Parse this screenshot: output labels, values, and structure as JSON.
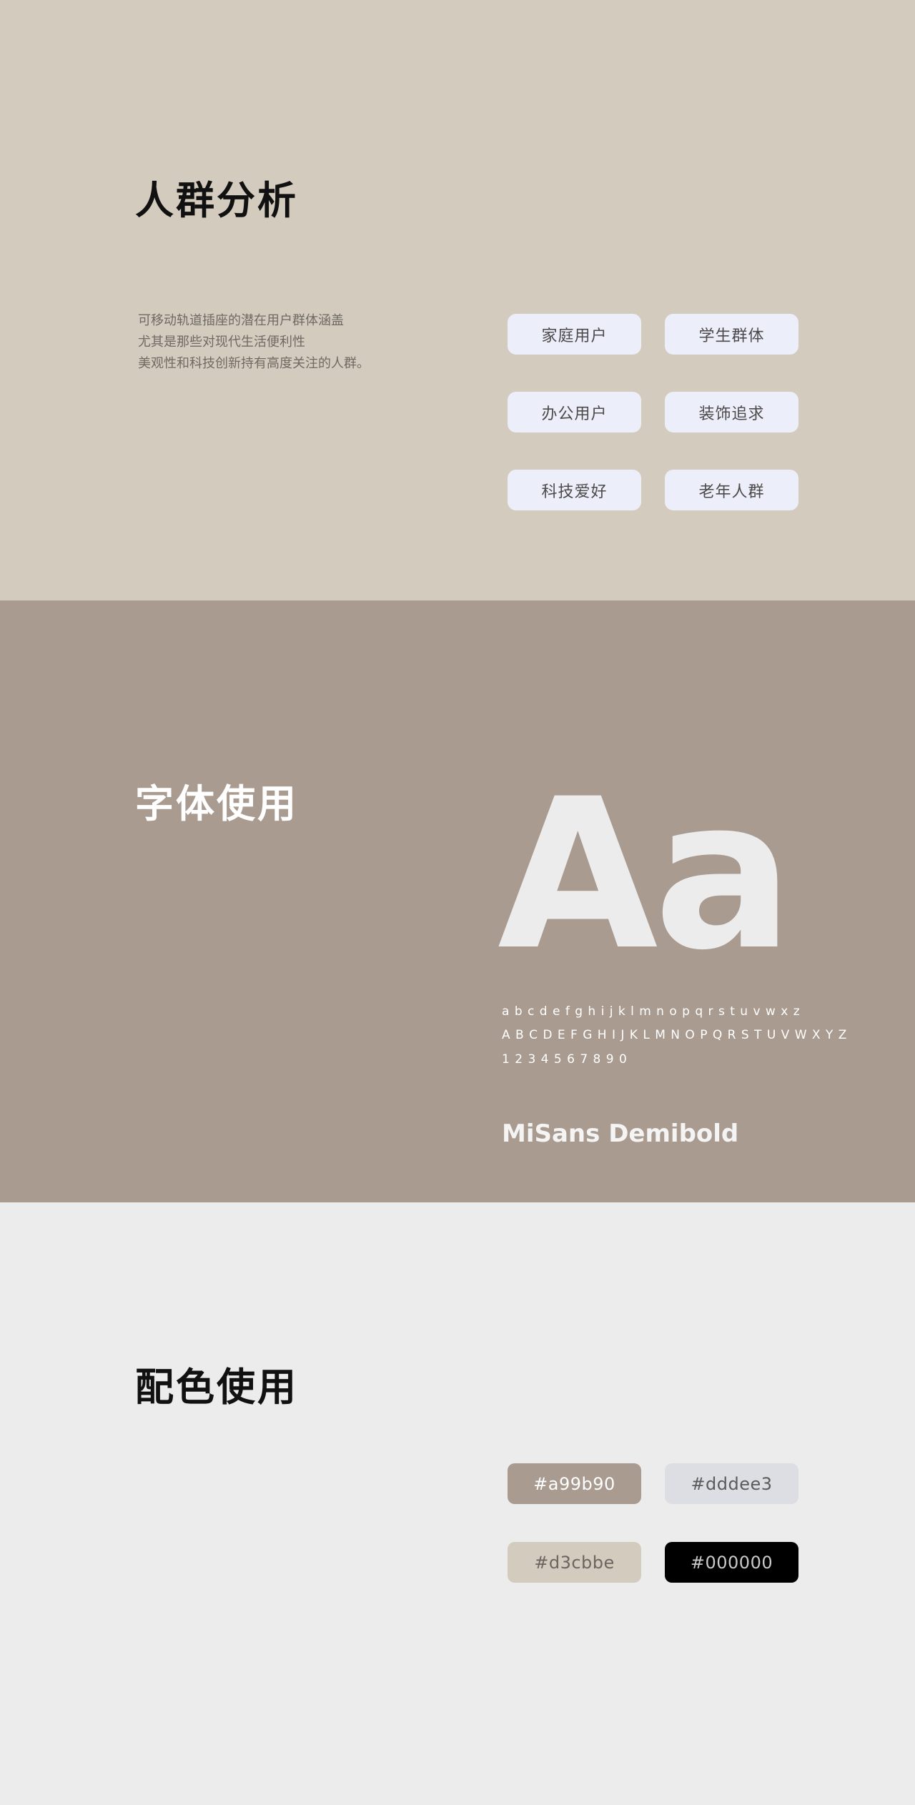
{
  "audience": {
    "title": "人群分析",
    "description": [
      "可移动轨道插座的潜在用户群体涵盖",
      "尤其是那些对现代生活便利性",
      "美观性和科技创新持有高度关注的人群。"
    ],
    "tags": [
      "家庭用户",
      "学生群体",
      "办公用户",
      "装饰追求",
      "科技爱好",
      "老年人群"
    ]
  },
  "typography": {
    "title": "字体使用",
    "sample": "Aa",
    "lowercase": "a b c d e f g h i j k l m n o p q r s t u v w x z",
    "uppercase": "A B C D E F G H I J K L M N O P Q R S T U V W X Y Z",
    "digits": "1 2 3 4 5 6 7 8 9 0",
    "font_name": "MiSans Demibold"
  },
  "colors": {
    "title": "配色使用",
    "swatches": [
      {
        "label": "#a99b90",
        "bg": "#a99b90",
        "fg": "#ffffff"
      },
      {
        "label": "#dddee3",
        "bg": "#dddee3",
        "fg": "#5b5b5b"
      },
      {
        "label": "#d3cbbe",
        "bg": "#d3cbbe",
        "fg": "#6b6661"
      },
      {
        "label": "#000000",
        "bg": "#000000",
        "fg": "#c9c9c9"
      }
    ]
  }
}
